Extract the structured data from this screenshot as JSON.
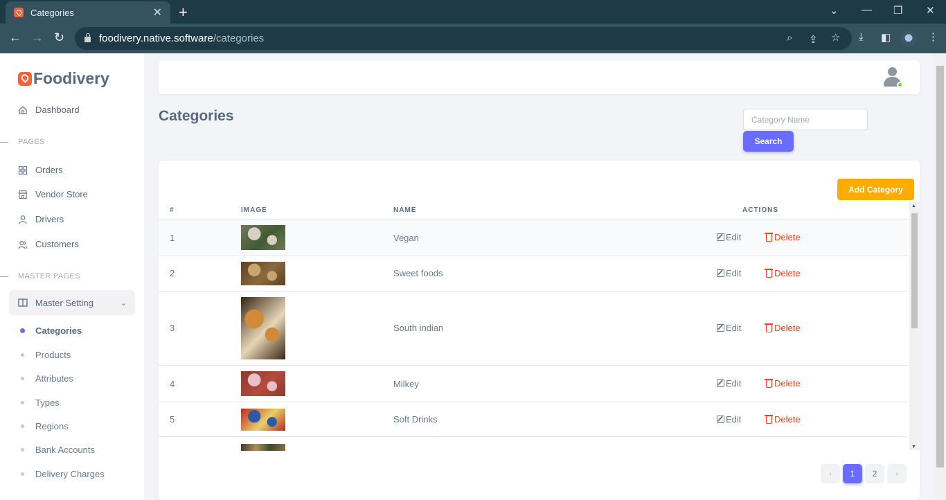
{
  "browser": {
    "tab_title": "Categories",
    "url_domain": "foodivery.native.software",
    "url_path": "/categories"
  },
  "sidebar": {
    "brand": "Foodivery",
    "dashboard": "Dashboard",
    "section_pages": "PAGES",
    "pages": [
      "Orders",
      "Vendor Store",
      "Drivers",
      "Customers"
    ],
    "section_master": "MASTER PAGES",
    "master_setting": "Master Setting",
    "submenu": [
      "Categories",
      "Products",
      "Attributes",
      "Types",
      "Regions",
      "Bank Accounts",
      "Delivery Charges"
    ],
    "active_submenu": "Categories"
  },
  "header": {
    "page_title": "Categories",
    "search_placeholder": "Category Name",
    "search_button": "Search"
  },
  "table": {
    "add_button": "Add Category",
    "columns": [
      "#",
      "IMAGE",
      "NAME",
      "ACTIONS"
    ],
    "rows": [
      {
        "num": "1",
        "name": "Vegan",
        "img_colors": [
          "#6f7a58",
          "#d6d1c4",
          "#405a33"
        ]
      },
      {
        "num": "2",
        "name": "Sweet foods",
        "img_colors": [
          "#5e3f22",
          "#c9a56b",
          "#8a6a3d"
        ]
      },
      {
        "num": "3",
        "name": "South indian",
        "img_colors": [
          "#3b2414",
          "#d08a3a",
          "#e6d6b6"
        ]
      },
      {
        "num": "4",
        "name": "Milkey",
        "img_colors": [
          "#8e3a2c",
          "#e7c1c8",
          "#b34b3e"
        ]
      },
      {
        "num": "5",
        "name": "Soft Drinks",
        "img_colors": [
          "#b9291e",
          "#2d5aa5",
          "#e8d06b"
        ]
      }
    ],
    "edit_label": "Edit",
    "delete_label": "Delete"
  },
  "pagination": {
    "prev": "‹",
    "pages": [
      "1",
      "2"
    ],
    "current": "1",
    "next": "›"
  },
  "colors": {
    "primary": "#696cff",
    "warning": "#ffab00",
    "danger": "#ff3e1d",
    "brand": "#f4623a"
  }
}
